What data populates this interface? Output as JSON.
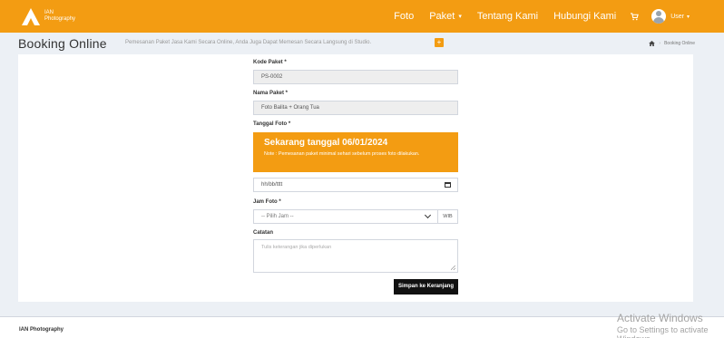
{
  "brand": {
    "line1": "IAN",
    "line2": "Photography"
  },
  "nav": {
    "items": [
      "Foto",
      "Paket",
      "Tentang Kami",
      "Hubungi Kami"
    ],
    "dropdown_caret": "▾",
    "user_label": "User"
  },
  "header": {
    "title": "Booking Online",
    "subtitle": "Pemesanan Paket Jasa Kami Secara Online, Anda Juga Dapat Memesan Secara Langsung di Studio.",
    "plus": "+",
    "breadcrumb": {
      "sep": "›",
      "current": "Booking Online"
    }
  },
  "form": {
    "kode_label": "Kode Paket *",
    "kode_value": "PS-0002",
    "nama_label": "Nama Paket *",
    "nama_value": "Foto Balita + Orang Tua",
    "tanggal_label": "Tanggal Foto *",
    "alert_title": "Sekarang tanggal 06/01/2024",
    "alert_note": "Note : Pemesanan paket minimal sehari sebelum proses foto dilakukan.",
    "date_placeholder": "hh/bb/tttt",
    "jam_label": "Jam Foto *",
    "jam_placeholder": "-- Pilih Jam --",
    "jam_suffix": "WIB",
    "catatan_label": "Catatan",
    "catatan_placeholder": "Tulis keterangan jika diperlukan",
    "submit_label": "Simpan ke Keranjang"
  },
  "footer": {
    "text": "IAN Photography"
  },
  "watermark": {
    "title": "Activate Windows",
    "sub": "Go to Settings to activate Windows."
  },
  "colors": {
    "accent": "#f39c12",
    "background": "#ecf0f5"
  },
  "icons": {
    "logo": "camera-logo-icon",
    "cart": "shopping-cart-icon",
    "home": "home-icon",
    "calendar": "calendar-icon",
    "select": "chevron-down-icon"
  }
}
